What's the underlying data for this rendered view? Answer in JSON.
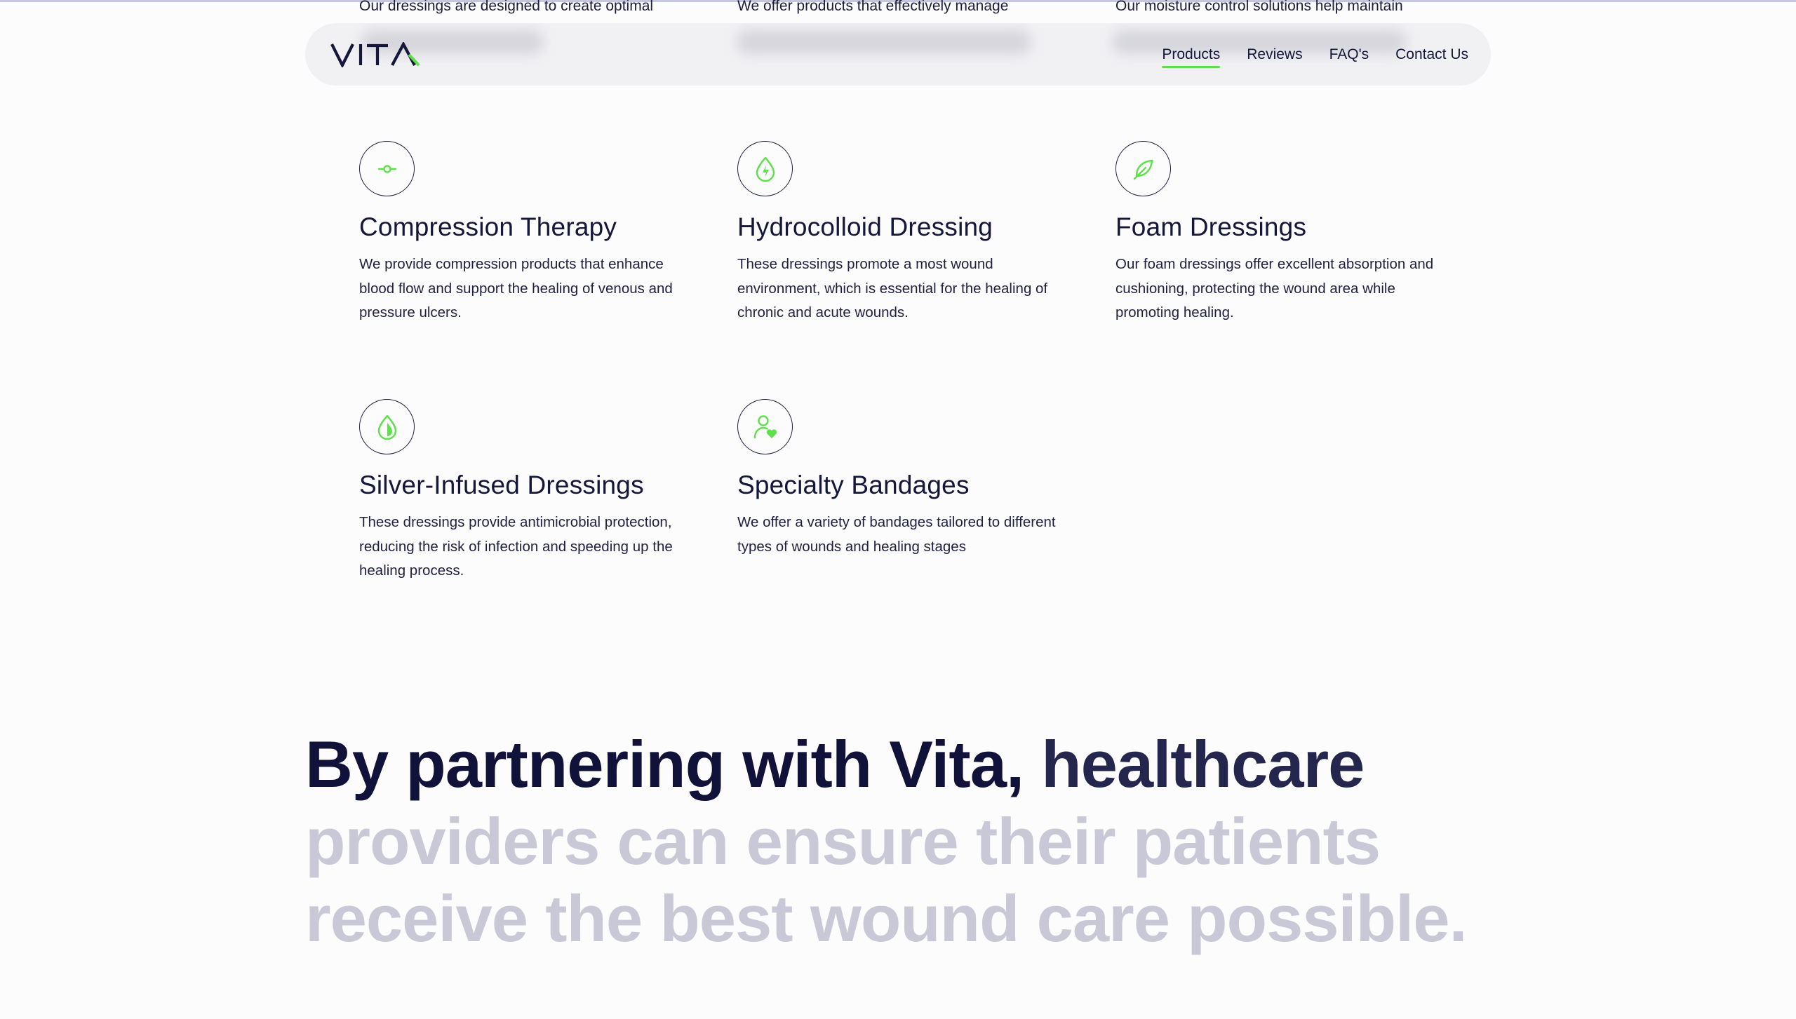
{
  "partial_row": {
    "col1": "Our dressings are designed to create optimal",
    "col2": "We offer products that effectively manage",
    "col3": "Our moisture control solutions help maintain"
  },
  "nav": {
    "logo_text": "VITA",
    "links": [
      {
        "label": "Products",
        "active": true
      },
      {
        "label": "Reviews"
      },
      {
        "label": "FAQ's"
      },
      {
        "label": "Contact Us"
      }
    ]
  },
  "features": [
    {
      "icon": "compression-icon",
      "title": "Compression Therapy",
      "description": "We provide compression products that enhance blood flow and support the healing of venous and pressure ulcers."
    },
    {
      "icon": "drop-bolt-icon",
      "title": "Hydrocolloid Dressing",
      "description": "These dressings promote a most wound environment, which is essential for the healing of chronic and acute wounds."
    },
    {
      "icon": "leaf-icon",
      "title": "Foam Dressings",
      "description": "Our foam dressings offer excellent absorption and cushioning, protecting the wound area while promoting healing."
    },
    {
      "icon": "half-drop-icon",
      "title": "Silver-Infused Dressings",
      "description": "These dressings provide antimicrobial protection, reducing the risk of infection and speeding up the healing process."
    },
    {
      "icon": "person-heart-icon",
      "title": "Specialty Bandages",
      "description": "We offer a variety of bandages tailored to different types of wounds and healing stages"
    }
  ],
  "statement": {
    "part_dark": "By partnering with Vita,",
    "part_mid": "healthcare",
    "part_light": "providers can ensure their patients receive the best wound care possible."
  },
  "colors": {
    "accent": "#5ee04a",
    "navy": "#14163a",
    "muted": "#c9c8d6"
  }
}
